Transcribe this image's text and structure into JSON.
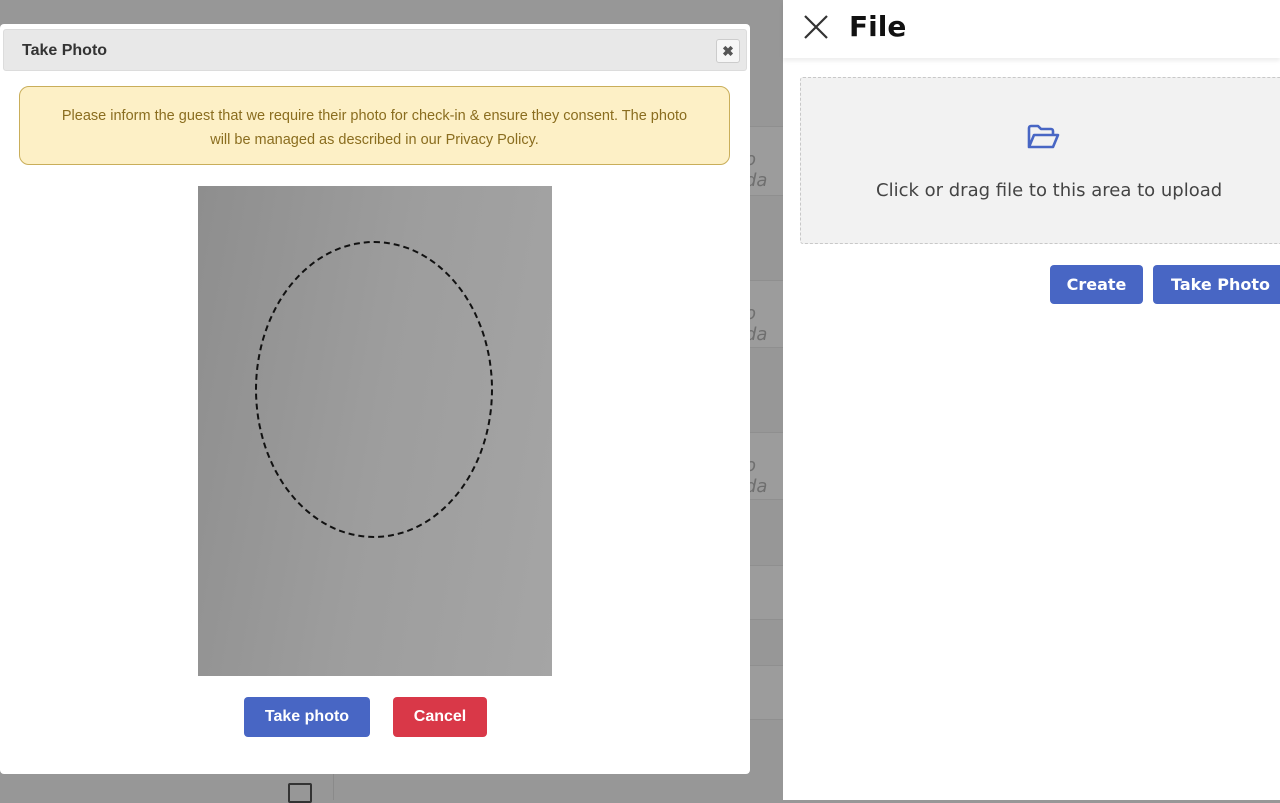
{
  "background": {
    "row_text": "o da",
    "rows": 3
  },
  "modal": {
    "title": "Take Photo",
    "close_icon": "close-icon",
    "notice": "Please inform the guest that we require their photo for check-in & ensure they consent. The photo will be managed as described in our Privacy Policy.",
    "take_photo_label": "Take photo",
    "cancel_label": "Cancel"
  },
  "panel": {
    "title": "File",
    "upload_text": "Click or drag file to this area to upload",
    "upload_icon": "folder-open-icon",
    "create_label": "Create",
    "take_photo_label": "Take Photo"
  },
  "colors": {
    "primary": "#4866c4",
    "danger": "#d93848",
    "notice_bg": "#fdf0c6"
  }
}
